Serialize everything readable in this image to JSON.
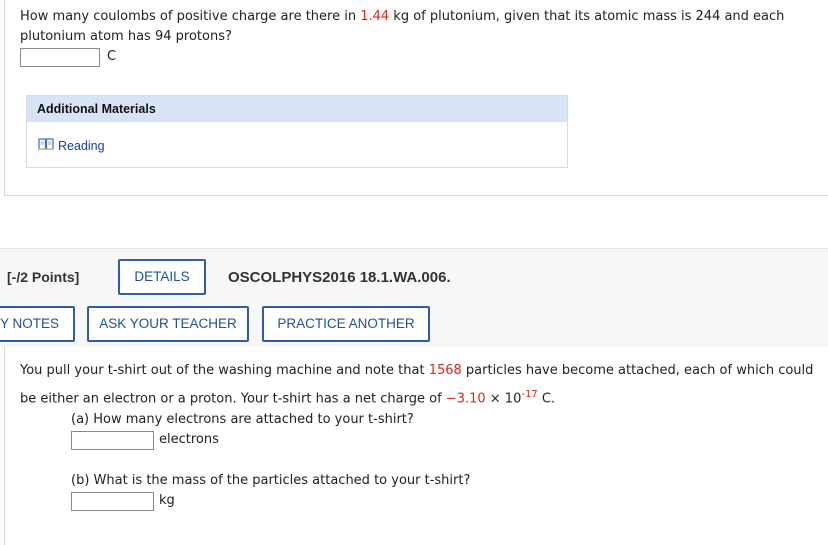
{
  "question1": {
    "text_part1": "How many coulombs of positive charge are there in ",
    "mass_value": "1.44",
    "text_part2": " kg of plutonium, given that its atomic mass is 244 and each",
    "text_line2": "plutonium atom has 94 protons?",
    "answer_value": "",
    "unit": "C"
  },
  "additional_materials": {
    "title": "Additional Materials",
    "reading_label": "Reading"
  },
  "question2_header": {
    "points": "[-/2 Points]",
    "details_label": "DETAILS",
    "code": "OSCOLPHYS2016 18.1.WA.006.",
    "notes_label": "Y NOTES",
    "ask_teacher_label": "ASK YOUR TEACHER",
    "practice_label": "PRACTICE ANOTHER"
  },
  "question2": {
    "line1_part1": "You pull your t-shirt out of the washing machine and note that ",
    "particles": "1568",
    "line1_part2": " particles have become attached, each of which could",
    "line2_part1": "be either an electron or a proton. Your t-shirt has a net charge of ",
    "charge_mantissa": "−3.10",
    "times": " × 10",
    "charge_exponent": "-17",
    "charge_unit": " C.",
    "part_a_prompt": "(a) How many electrons are attached to your t-shirt?",
    "part_a_value": "",
    "part_a_unit": "electrons",
    "part_b_prompt": "(b) What is the mass of the particles attached to your t-shirt?",
    "part_b_value": "",
    "part_b_unit": "kg"
  },
  "colors": {
    "highlight_red": "#e0261b",
    "button_blue": "#2f5dab",
    "materials_header_bg": "#d9e3f7",
    "link_blue": "#1a40b0"
  }
}
